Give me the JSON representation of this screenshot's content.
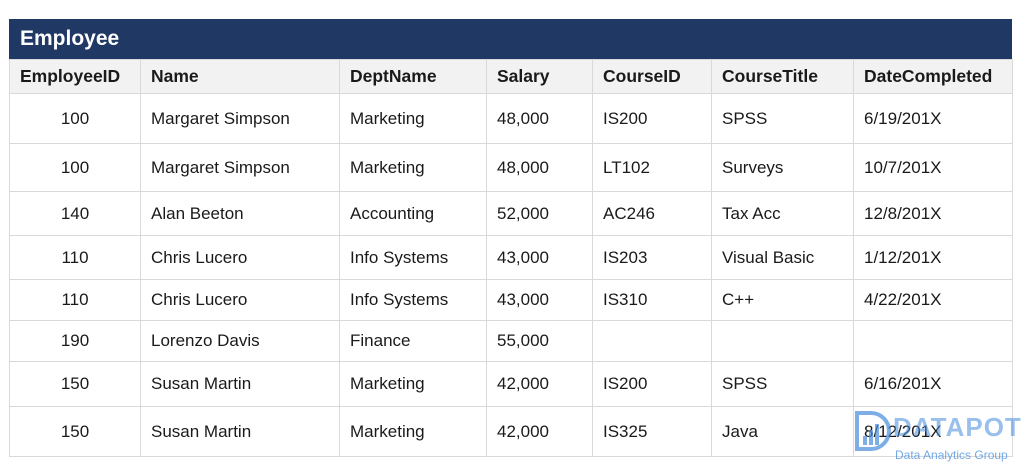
{
  "table_title": "Employee",
  "columns": [
    "EmployeeID",
    "Name",
    "DeptName",
    "Salary",
    "CourseID",
    "CourseTitle",
    "DateCompleted"
  ],
  "rows": [
    [
      "100",
      "Margaret Simpson",
      "Marketing",
      "48,000",
      "IS200",
      "SPSS",
      "6/19/201X"
    ],
    [
      "100",
      "Margaret Simpson",
      "Marketing",
      "48,000",
      "LT102",
      "Surveys",
      "10/7/201X"
    ],
    [
      "140",
      "Alan Beeton",
      "Accounting",
      "52,000",
      "AC246",
      "Tax Acc",
      "12/8/201X"
    ],
    [
      "110",
      "Chris Lucero",
      "Info Systems",
      "43,000",
      "IS203",
      "Visual Basic",
      "1/12/201X"
    ],
    [
      "110",
      "Chris Lucero",
      "Info Systems",
      "43,000",
      "IS310",
      "C++",
      "4/22/201X"
    ],
    [
      "190",
      "Lorenzo Davis",
      "Finance",
      "55,000",
      "",
      "",
      ""
    ],
    [
      "150",
      "Susan Martin",
      "Marketing",
      "42,000",
      "IS200",
      "SPSS",
      "6/16/201X"
    ],
    [
      "150",
      "Susan Martin",
      "Marketing",
      "42,000",
      "IS325",
      "Java",
      "8/12/201X"
    ]
  ],
  "watermark": {
    "brand": "DATAPOT",
    "tagline": "Data Analytics Group",
    "color": "#4a8cdc"
  },
  "colors": {
    "header_bar": "#1f3864",
    "column_header_bg": "#f2f2f2",
    "grid": "#d9d9d9"
  }
}
